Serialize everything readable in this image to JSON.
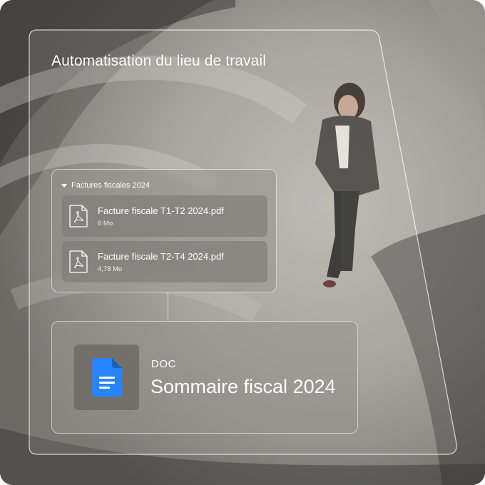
{
  "header": {
    "title": "Automatisation du lieu de travail"
  },
  "folder": {
    "name": "Factures fiscales 2024",
    "files": [
      {
        "name": "Facture fiscale T1-T2 2024.pdf",
        "size": "6 Mo",
        "icon": "pdf-icon"
      },
      {
        "name": "Facture fiscale T2-T4 2024.pdf",
        "size": "4,78 Mo",
        "icon": "pdf-icon"
      }
    ]
  },
  "document": {
    "type": "DOC",
    "title": "Sommaire fiscal 2024",
    "icon": "google-docs-icon"
  },
  "colors": {
    "glass_border": "#ffffff",
    "text": "#ffffff",
    "docs_blue": "#2684fc",
    "docs_fold": "#1a5fbf"
  }
}
